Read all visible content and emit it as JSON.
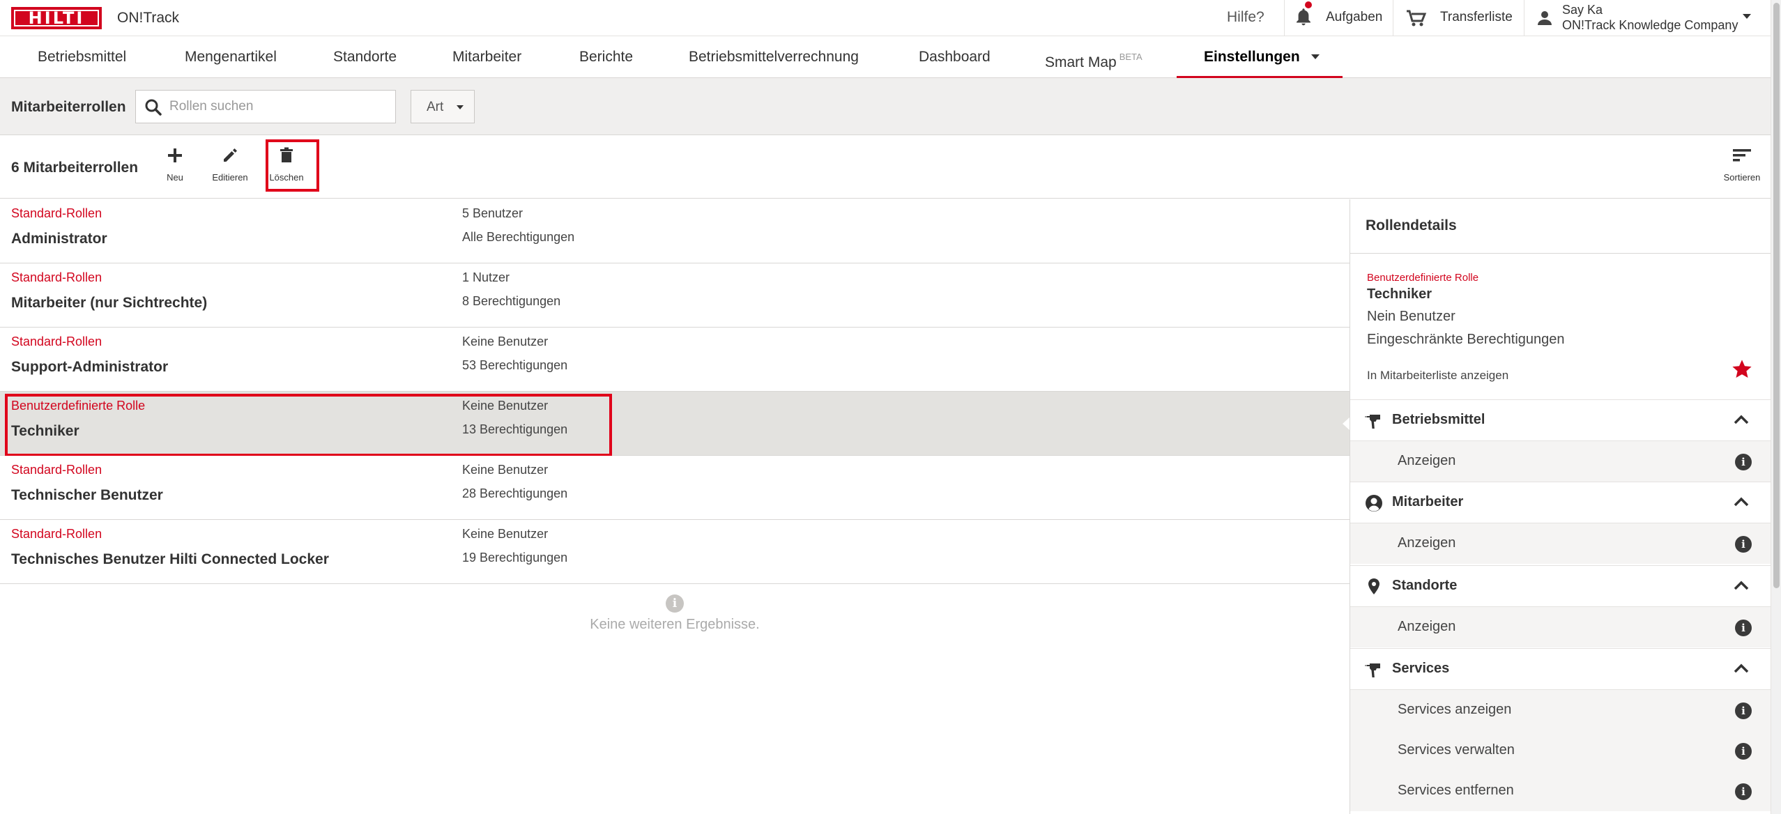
{
  "header": {
    "logo_text": "HILTI",
    "app_name": "ON!Track",
    "help": "Hilfe?",
    "tasks": "Aufgaben",
    "transfer_list": "Transferliste",
    "user_name": "Say Ka",
    "user_company": "ON!Track Knowledge Company",
    "accent_color": "#d2051e"
  },
  "nav": {
    "items": [
      {
        "label": "Betriebsmittel"
      },
      {
        "label": "Mengenartikel"
      },
      {
        "label": "Standorte"
      },
      {
        "label": "Mitarbeiter"
      },
      {
        "label": "Berichte"
      },
      {
        "label": "Betriebsmittelverrechnung"
      },
      {
        "label": "Dashboard"
      },
      {
        "label": "Smart Map",
        "badge": "BETA"
      },
      {
        "label": "Einstellungen",
        "active": true
      }
    ]
  },
  "filter": {
    "title": "Mitarbeiterrollen",
    "search_placeholder": "Rollen suchen",
    "type_select": "Art"
  },
  "toolbar": {
    "count": "6 Mitarbeiterrollen",
    "new_label": "Neu",
    "edit_label": "Editieren",
    "delete_label": "Löschen",
    "sort_label": "Sortieren"
  },
  "roles": [
    {
      "type": "Standard-Rollen",
      "name": "Administrator",
      "users": "5 Benutzer",
      "permissions": "Alle Berechtigungen"
    },
    {
      "type": "Standard-Rollen",
      "name": "Mitarbeiter (nur Sichtrechte)",
      "users": "1 Nutzer",
      "permissions": "8 Berechtigungen"
    },
    {
      "type": "Standard-Rollen",
      "name": "Support-Administrator",
      "users": "Keine Benutzer",
      "permissions": "53 Berechtigungen"
    },
    {
      "type": "Benutzerdefinierte Rolle",
      "name": "Techniker",
      "users": "Keine Benutzer",
      "permissions": "13 Berechtigungen",
      "selected": true
    },
    {
      "type": "Standard-Rollen",
      "name": "Technischer Benutzer",
      "users": "Keine Benutzer",
      "permissions": "28 Berechtigungen"
    },
    {
      "type": "Standard-Rollen",
      "name": "Technisches Benutzer Hilti Connected Locker",
      "users": "Keine Benutzer",
      "permissions": "19 Berechtigungen"
    }
  ],
  "no_more_results": "Keine weiteren Ergebnisse.",
  "details": {
    "title": "Rollendetails",
    "type": "Benutzerdefinierte Rolle",
    "name": "Techniker",
    "users": "Nein Benutzer",
    "permissions": "Eingeschränkte Berechtigungen",
    "show_in_list": "In Mitarbeiterliste anzeigen",
    "sections": [
      {
        "label": "Betriebsmittel",
        "icon": "drill-icon",
        "permissions": [
          "Anzeigen"
        ]
      },
      {
        "label": "Mitarbeiter",
        "icon": "person-circle-icon",
        "permissions": [
          "Anzeigen"
        ]
      },
      {
        "label": "Standorte",
        "icon": "location-pin-icon",
        "permissions": [
          "Anzeigen"
        ]
      },
      {
        "label": "Services",
        "icon": "drill-icon",
        "permissions": [
          "Services anzeigen",
          "Services verwalten",
          "Services entfernen"
        ]
      }
    ]
  }
}
